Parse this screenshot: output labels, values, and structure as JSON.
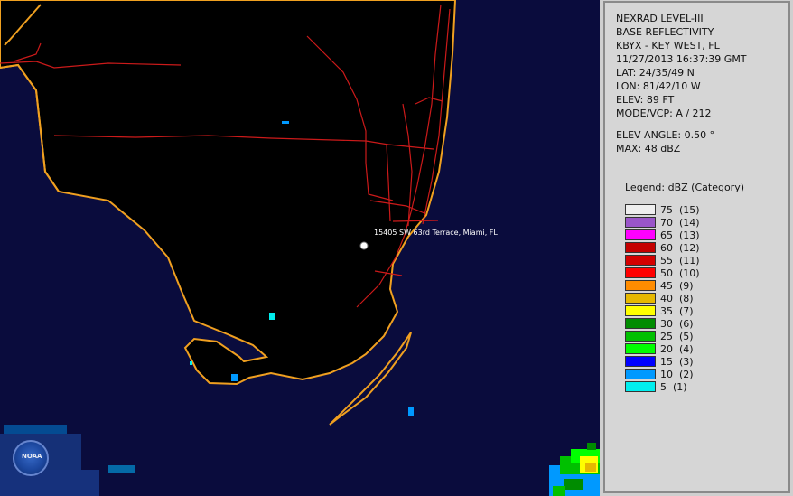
{
  "info": {
    "product": "NEXRAD LEVEL-III",
    "type": "BASE REFLECTIVITY",
    "station": "KBYX - KEY WEST, FL",
    "datetime": "11/27/2013 16:37:39 GMT",
    "lat": "LAT: 24/35/49 N",
    "lon": "LON: 81/42/10 W",
    "elev": "ELEV: 89 FT",
    "mode": "MODE/VCP: A / 212",
    "elev_angle": "ELEV ANGLE: 0.50 °",
    "max": "MAX: 48 dBZ"
  },
  "legend": {
    "title": "Legend: dBZ (Category)",
    "items": [
      {
        "label": "75  (15)",
        "color": "#eeeeee"
      },
      {
        "label": "70  (14)",
        "color": "#9a55c9"
      },
      {
        "label": "65  (13)",
        "color": "#ff00ff"
      },
      {
        "label": "60  (12)",
        "color": "#c40000"
      },
      {
        "label": "55  (11)",
        "color": "#d40000"
      },
      {
        "label": "50  (10)",
        "color": "#ff0000"
      },
      {
        "label": "45  (9)",
        "color": "#ff8c00"
      },
      {
        "label": "40  (8)",
        "color": "#e6b800"
      },
      {
        "label": "35  (7)",
        "color": "#ffff00"
      },
      {
        "label": "30  (6)",
        "color": "#008c00"
      },
      {
        "label": "25  (5)",
        "color": "#00c000"
      },
      {
        "label": "20  (4)",
        "color": "#00ff00"
      },
      {
        "label": "15  (3)",
        "color": "#0000ff"
      },
      {
        "label": "10  (2)",
        "color": "#0099ff"
      },
      {
        "label": "5  (1)",
        "color": "#00eeee"
      }
    ]
  },
  "map": {
    "marker_label": "15405 SW 63rd Terrace, Miami, FL",
    "logo_text": "NOAA",
    "colors": {
      "ocean": "#0a0c3d",
      "land": "#000000",
      "coast": "#f0a020",
      "roads": "#cc1a1a",
      "marker": "#ffffff"
    }
  }
}
